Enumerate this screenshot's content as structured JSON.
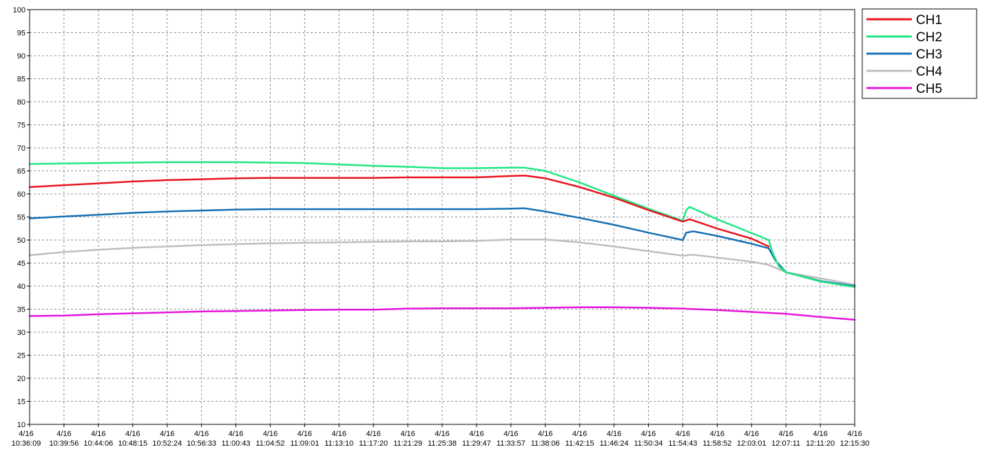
{
  "chart_data": {
    "type": "line",
    "title": "",
    "xlabel": "",
    "ylabel": "",
    "ylim": [
      10,
      100
    ],
    "y_ticks": [
      10,
      15,
      20,
      25,
      30,
      35,
      40,
      45,
      50,
      55,
      60,
      65,
      70,
      75,
      80,
      85,
      90,
      95,
      100
    ],
    "x_tick_labels": [
      {
        "date": "4/16",
        "time": "10:36:09"
      },
      {
        "date": "4/16",
        "time": "10:39:56"
      },
      {
        "date": "4/16",
        "time": "10:44:06"
      },
      {
        "date": "4/16",
        "time": "10:48:15"
      },
      {
        "date": "4/16",
        "time": "10:52:24"
      },
      {
        "date": "4/16",
        "time": "10:56:33"
      },
      {
        "date": "4/16",
        "time": "11:00:43"
      },
      {
        "date": "4/16",
        "time": "11:04:52"
      },
      {
        "date": "4/16",
        "time": "11:09:01"
      },
      {
        "date": "4/16",
        "time": "11:13:10"
      },
      {
        "date": "4/16",
        "time": "11:17:20"
      },
      {
        "date": "4/16",
        "time": "11:21:29"
      },
      {
        "date": "4/16",
        "time": "11:25:38"
      },
      {
        "date": "4/16",
        "time": "11:29:47"
      },
      {
        "date": "4/16",
        "time": "11:33:57"
      },
      {
        "date": "4/16",
        "time": "11:38:06"
      },
      {
        "date": "4/16",
        "time": "11:42:15"
      },
      {
        "date": "4/16",
        "time": "11:46:24"
      },
      {
        "date": "4/16",
        "time": "11:50:34"
      },
      {
        "date": "4/16",
        "time": "11:54:43"
      },
      {
        "date": "4/16",
        "time": "11:58:52"
      },
      {
        "date": "4/16",
        "time": "12:03:01"
      },
      {
        "date": "4/16",
        "time": "12:07:11"
      },
      {
        "date": "4/16",
        "time": "12:11:20"
      },
      {
        "date": "4/16",
        "time": "12:15:30"
      }
    ],
    "grid": true,
    "legend_position": "top-right",
    "series": [
      {
        "name": "CH1",
        "color": "#e8141e",
        "points": [
          [
            0,
            61.5
          ],
          [
            1,
            61.9
          ],
          [
            2,
            62.3
          ],
          [
            3,
            62.7
          ],
          [
            4,
            63.0
          ],
          [
            5,
            63.2
          ],
          [
            6,
            63.4
          ],
          [
            7,
            63.5
          ],
          [
            8,
            63.5
          ],
          [
            9,
            63.5
          ],
          [
            10,
            63.5
          ],
          [
            11,
            63.6
          ],
          [
            12,
            63.6
          ],
          [
            13,
            63.6
          ],
          [
            14,
            63.9
          ],
          [
            14.4,
            64.0
          ],
          [
            15,
            63.4
          ],
          [
            16,
            61.5
          ],
          [
            17,
            59.2
          ],
          [
            18,
            56.5
          ],
          [
            19,
            54.0
          ],
          [
            19.2,
            54.5
          ],
          [
            20,
            52.5
          ],
          [
            21,
            50.3
          ],
          [
            21.5,
            48.6
          ]
        ]
      },
      {
        "name": "CH2",
        "color": "#1ee882",
        "points": [
          [
            0,
            66.5
          ],
          [
            1,
            66.6
          ],
          [
            2,
            66.7
          ],
          [
            3,
            66.8
          ],
          [
            4,
            66.9
          ],
          [
            5,
            66.9
          ],
          [
            6,
            66.9
          ],
          [
            7,
            66.8
          ],
          [
            8,
            66.7
          ],
          [
            9,
            66.4
          ],
          [
            10,
            66.1
          ],
          [
            11,
            65.9
          ],
          [
            12,
            65.6
          ],
          [
            13,
            65.6
          ],
          [
            14,
            65.7
          ],
          [
            14.4,
            65.7
          ],
          [
            15,
            65.0
          ],
          [
            16,
            62.5
          ],
          [
            17,
            59.6
          ],
          [
            18,
            56.8
          ],
          [
            19,
            54.2
          ],
          [
            19.1,
            56.5
          ],
          [
            19.2,
            57.2
          ],
          [
            20,
            54.5
          ],
          [
            21,
            51.5
          ],
          [
            21.5,
            50.0
          ],
          [
            21.6,
            47.5
          ],
          [
            21.8,
            44.2
          ],
          [
            22,
            43.0
          ],
          [
            22.5,
            42.0
          ],
          [
            23,
            41.0
          ],
          [
            24,
            39.8
          ]
        ]
      },
      {
        "name": "CH3",
        "color": "#1470b4",
        "points": [
          [
            0,
            54.7
          ],
          [
            1,
            55.1
          ],
          [
            2,
            55.5
          ],
          [
            3,
            55.9
          ],
          [
            4,
            56.2
          ],
          [
            5,
            56.4
          ],
          [
            6,
            56.6
          ],
          [
            7,
            56.7
          ],
          [
            8,
            56.7
          ],
          [
            9,
            56.7
          ],
          [
            10,
            56.7
          ],
          [
            11,
            56.7
          ],
          [
            12,
            56.7
          ],
          [
            13,
            56.7
          ],
          [
            14,
            56.8
          ],
          [
            14.4,
            56.9
          ],
          [
            15,
            56.2
          ],
          [
            16,
            54.8
          ],
          [
            17,
            53.3
          ],
          [
            18,
            51.6
          ],
          [
            19,
            50.0
          ],
          [
            19.1,
            51.6
          ],
          [
            19.3,
            51.9
          ],
          [
            20,
            50.9
          ],
          [
            21,
            49.2
          ],
          [
            21.5,
            48.2
          ],
          [
            21.7,
            45.5
          ],
          [
            22,
            43.0
          ],
          [
            23,
            41.1
          ],
          [
            24,
            40.0
          ]
        ]
      },
      {
        "name": "CH4",
        "color": "#bebebe",
        "points": [
          [
            0,
            46.7
          ],
          [
            1,
            47.4
          ],
          [
            2,
            47.9
          ],
          [
            3,
            48.3
          ],
          [
            4,
            48.6
          ],
          [
            5,
            48.9
          ],
          [
            6,
            49.1
          ],
          [
            7,
            49.3
          ],
          [
            8,
            49.4
          ],
          [
            9,
            49.5
          ],
          [
            10,
            49.6
          ],
          [
            11,
            49.7
          ],
          [
            12,
            49.7
          ],
          [
            13,
            49.8
          ],
          [
            14,
            50.1
          ],
          [
            15,
            50.1
          ],
          [
            16,
            49.5
          ],
          [
            17,
            48.6
          ],
          [
            18,
            47.6
          ],
          [
            19,
            46.6
          ],
          [
            19.3,
            46.8
          ],
          [
            20,
            46.2
          ],
          [
            21,
            45.3
          ],
          [
            21.5,
            44.6
          ],
          [
            22,
            43.0
          ],
          [
            23,
            41.7
          ],
          [
            24,
            40.3
          ]
        ]
      },
      {
        "name": "CH5",
        "color": "#e414dc",
        "points": [
          [
            0,
            33.5
          ],
          [
            1,
            33.6
          ],
          [
            2,
            33.9
          ],
          [
            3,
            34.1
          ],
          [
            4,
            34.3
          ],
          [
            5,
            34.5
          ],
          [
            6,
            34.6
          ],
          [
            7,
            34.7
          ],
          [
            8,
            34.8
          ],
          [
            9,
            34.9
          ],
          [
            10,
            34.9
          ],
          [
            11,
            35.1
          ],
          [
            12,
            35.2
          ],
          [
            13,
            35.2
          ],
          [
            14,
            35.2
          ],
          [
            15,
            35.3
          ],
          [
            16,
            35.4
          ],
          [
            17,
            35.4
          ],
          [
            18,
            35.3
          ],
          [
            19,
            35.1
          ],
          [
            20,
            34.8
          ],
          [
            21,
            34.4
          ],
          [
            22,
            34.0
          ],
          [
            23,
            33.3
          ],
          [
            24,
            32.7
          ]
        ]
      }
    ]
  }
}
